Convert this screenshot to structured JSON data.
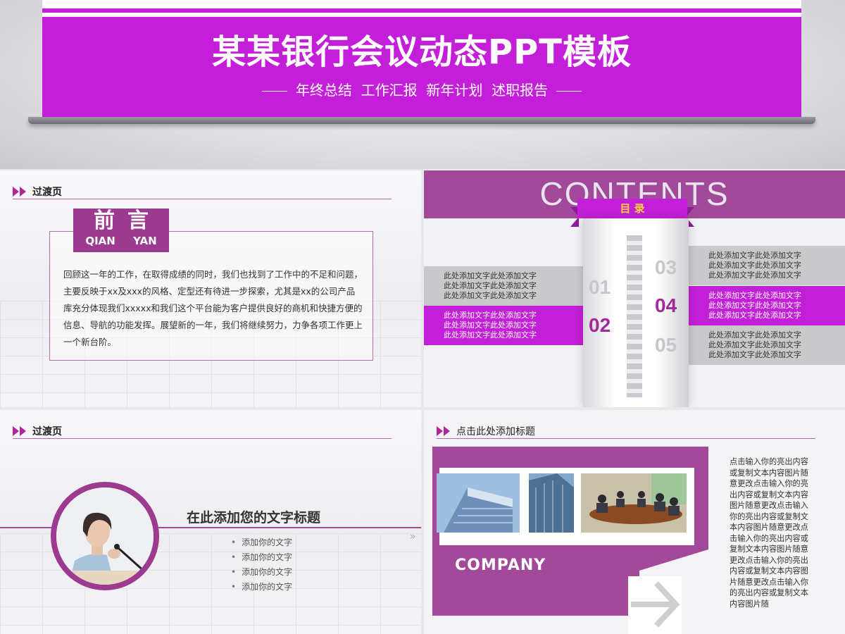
{
  "banner": {
    "title": "某某银行会议动态PPT模板",
    "subtitle": "年终总结  工作汇报  新年计划  述职报告"
  },
  "slide1": {
    "header": "过渡页",
    "tag_cn": "前言",
    "tag_py_1": "QIAN",
    "tag_py_2": "YAN",
    "body": "回顾这一年的工作，在取得成绩的同时，我们也找到了工作中的不足和问题，主要反映于xx及xxx的风格、定型还有待进一步探索，尤其是xx的公司产品库充分体现我们xxxxx和我们这个平台能为客户提供良好的商机和快捷方便的信息、导航的功能发挥。展望新的一年，我们将继续努力，力争各项工作更上一个新台阶。"
  },
  "slide2": {
    "title": "CONTENTS",
    "ribbon": "目 录",
    "items": [
      {
        "num": "01",
        "text": "此处添加文字此处添加文字\n此处添加文字此处添加文字\n此处添加文字此处添加文字"
      },
      {
        "num": "02",
        "text": "此处添加文字此处添加文字\n此处添加文字此处添加文字\n此处添加文字此处添加文字"
      },
      {
        "num": "03",
        "text": "此处添加文字此处添加文字\n此处添加文字此处添加文字\n此处添加文字此处添加文字"
      },
      {
        "num": "04",
        "text": "此处添加文字此处添加文字\n此处添加文字此处添加文字\n此处添加文字此处添加文字"
      },
      {
        "num": "05",
        "text": "此处添加文字此处添加文字\n此处添加文字此处添加文字\n此处添加文字此处添加文字"
      }
    ]
  },
  "slide3": {
    "header": "过渡页",
    "title": "在此添加您的文字标题",
    "bullets": [
      "添加你的文字",
      "添加你的文字",
      "添加你的文字",
      "添加你的文字"
    ],
    "arrow": "»"
  },
  "slide4": {
    "header": "点击此处添加标题",
    "company": "COMPANY",
    "body": "点击输入你的亮出内容或复制文本内容图片随意更改点击输入你的亮出内容或复制文本内容图片随意更改点击输入你的亮出内容或复制文本内容图片随意更改点击输入你的亮出内容或复制文本内容图片随意更改点击输入你的亮出内容或复制文本内容图片随意更改点击输入你的亮出内容或复制文本内容图片随"
  },
  "colors": {
    "accent": "#c41fd8",
    "purple_dark": "#a3499a",
    "gray_row": "#c9c9cc"
  }
}
